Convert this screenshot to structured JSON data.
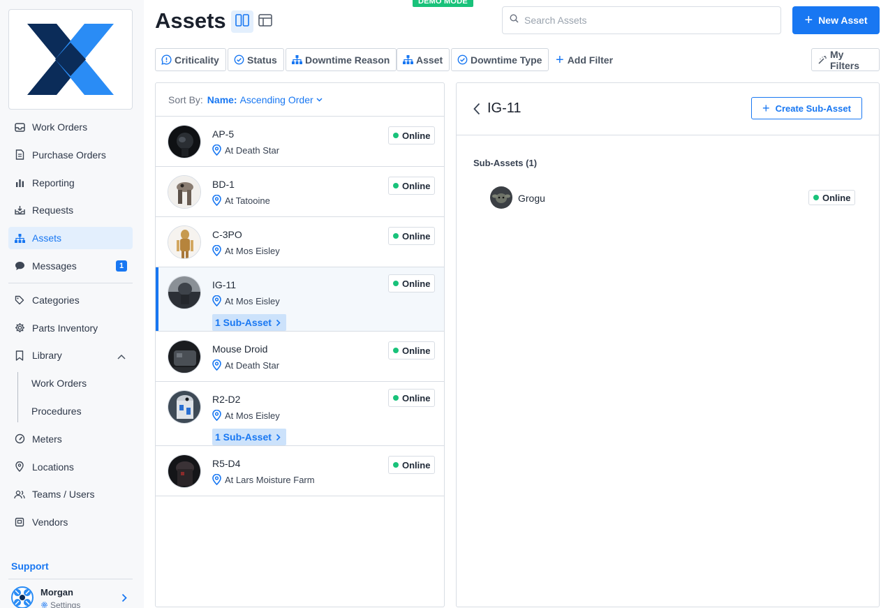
{
  "app": {
    "demo_tag": "DEMO MODE"
  },
  "sidebar": {
    "items": [
      {
        "label": "Work Orders",
        "icon": "inbox-icon"
      },
      {
        "label": "Purchase Orders",
        "icon": "document-icon"
      },
      {
        "label": "Reporting",
        "icon": "bar-chart-icon"
      },
      {
        "label": "Requests",
        "icon": "inbox-download-icon"
      },
      {
        "label": "Assets",
        "icon": "hierarchy-icon",
        "active": true
      },
      {
        "label": "Messages",
        "icon": "chat-icon",
        "badge": "1"
      }
    ],
    "items2": [
      {
        "label": "Categories",
        "icon": "tag-icon"
      },
      {
        "label": "Parts Inventory",
        "icon": "gear-icon"
      },
      {
        "label": "Library",
        "icon": "bookmark-icon"
      }
    ],
    "library_children": [
      "Work Orders",
      "Procedures"
    ],
    "items3": [
      {
        "label": "Meters",
        "icon": "gauge-icon"
      },
      {
        "label": "Locations",
        "icon": "location-pin-icon"
      },
      {
        "label": "Teams / Users",
        "icon": "users-icon"
      },
      {
        "label": "Vendors",
        "icon": "vendor-icon"
      }
    ],
    "support_label": "Support",
    "user": {
      "name": "Morgan",
      "settings_label": "Settings"
    }
  },
  "header": {
    "title": "Assets",
    "search_placeholder": "Search Assets",
    "new_button": "New Asset"
  },
  "filters": [
    {
      "label": "Criticality",
      "icon": "chat-alert-icon"
    },
    {
      "label": "Status",
      "icon": "check-circle-icon"
    },
    {
      "label": "Downtime Reason",
      "icon": "hierarchy-icon"
    },
    {
      "label": "Asset",
      "icon": "hierarchy-icon"
    },
    {
      "label": "Downtime Type",
      "icon": "check-circle-icon"
    }
  ],
  "add_filter_label": "Add Filter",
  "my_filters_label": "My Filters",
  "sort": {
    "prefix": "Sort By:",
    "key": "Name:",
    "value": "Ascending Order"
  },
  "assets": [
    {
      "name": "AP-5",
      "location": "At Death Star",
      "status": "Online"
    },
    {
      "name": "BD-1",
      "location": "At Tatooine",
      "status": "Online"
    },
    {
      "name": "C-3PO",
      "location": "At Mos Eisley",
      "status": "Online"
    },
    {
      "name": "IG-11",
      "location": "At Mos Eisley",
      "status": "Online",
      "sub_assets": "1 Sub-Asset",
      "selected": true
    },
    {
      "name": "Mouse Droid",
      "location": "At Death Star",
      "status": "Online"
    },
    {
      "name": "R2-D2",
      "location": "At Mos Eisley",
      "status": "Online",
      "sub_assets": "1 Sub-Asset"
    },
    {
      "name": "R5-D4",
      "location": "At Lars Moisture Farm",
      "status": "Online"
    }
  ],
  "detail": {
    "title": "IG-11",
    "create_button": "Create Sub-Asset",
    "sub_assets_title": "Sub-Assets (1)",
    "sub_assets": [
      {
        "name": "Grogu",
        "status": "Online"
      }
    ]
  },
  "colors": {
    "accent": "#1877f2",
    "online": "#19c27a",
    "active_bg": "#e3effd"
  }
}
